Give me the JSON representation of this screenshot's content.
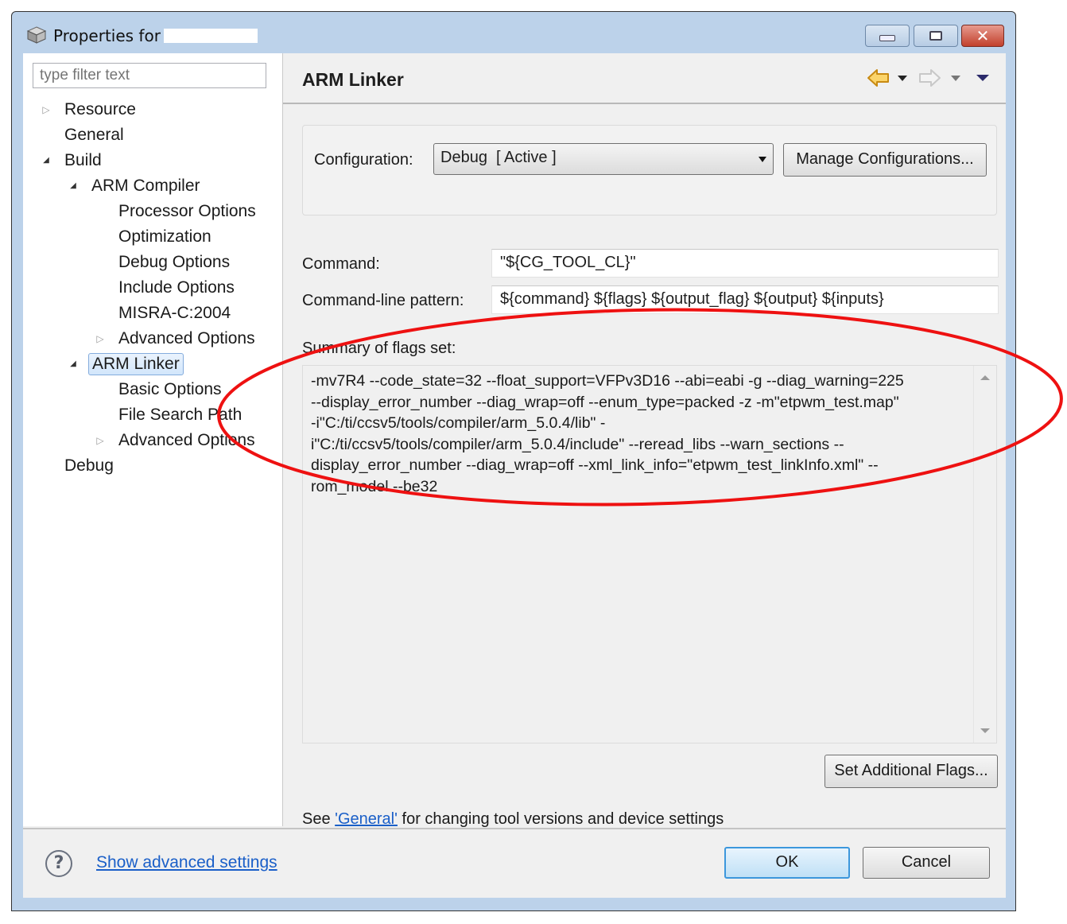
{
  "window": {
    "title": "Properties for",
    "title_redacted": true,
    "controls": {
      "minimize": "minimize",
      "maximize": "maximize",
      "close": "close"
    }
  },
  "sidebar": {
    "filter_placeholder": "type filter text",
    "tree": [
      {
        "label": "Resource",
        "level": 0,
        "twisty": "collapsed"
      },
      {
        "label": "General",
        "level": 0,
        "twisty": "none"
      },
      {
        "label": "Build",
        "level": 0,
        "twisty": "expanded"
      },
      {
        "label": "ARM Compiler",
        "level": 1,
        "twisty": "expanded"
      },
      {
        "label": "Processor Options",
        "level": 2,
        "twisty": "none"
      },
      {
        "label": "Optimization",
        "level": 2,
        "twisty": "none"
      },
      {
        "label": "Debug Options",
        "level": 2,
        "twisty": "none"
      },
      {
        "label": "Include Options",
        "level": 2,
        "twisty": "none"
      },
      {
        "label": "MISRA-C:2004",
        "level": 2,
        "twisty": "none"
      },
      {
        "label": "Advanced Options",
        "level": 2,
        "twisty": "collapsed"
      },
      {
        "label": "ARM Linker",
        "level": 1,
        "twisty": "expanded",
        "selected": true
      },
      {
        "label": "Basic Options",
        "level": 2,
        "twisty": "none"
      },
      {
        "label": "File Search Path",
        "level": 2,
        "twisty": "none"
      },
      {
        "label": "Advanced Options",
        "level": 2,
        "twisty": "collapsed"
      },
      {
        "label": "Debug",
        "level": 0,
        "twisty": "none"
      }
    ]
  },
  "content": {
    "page_title": "ARM Linker",
    "configuration_label": "Configuration:",
    "configuration_value": "Debug  [ Active ]",
    "manage_configurations": "Manage Configurations...",
    "command_label": "Command:",
    "command_value": "\"${CG_TOOL_CL}\"",
    "pattern_label": "Command-line pattern:",
    "pattern_value": "${command} ${flags} ${output_flag} ${output} ${inputs}",
    "summary_label": "Summary of flags set:",
    "summary_lines": [
      "-mv7R4 --code_state=32 --float_support=VFPv3D16 --abi=eabi -g --diag_warning=225",
      "--display_error_number --diag_wrap=off --enum_type=packed -z -m\"etpwm_test.map\"",
      "-i\"C:/ti/ccsv5/tools/compiler/arm_5.0.4/lib\" -",
      "i\"C:/ti/ccsv5/tools/compiler/arm_5.0.4/include\" --reread_libs --warn_sections --",
      "display_error_number --diag_wrap=off --xml_link_info=\"etpwm_test_linkInfo.xml\" --",
      "rom_model --be32"
    ],
    "set_additional_flags": "Set Additional Flags...",
    "footer_see": "See ",
    "footer_link": "'General'",
    "footer_rest": " for changing tool versions and device settings"
  },
  "bottom": {
    "show_advanced": "Show advanced settings",
    "ok": "OK",
    "cancel": "Cancel"
  },
  "annotation": {
    "type": "red-ellipse",
    "color": "#ee1111",
    "encircles": "summary-of-flags"
  },
  "colors": {
    "accent": "#3c97dc",
    "link": "#1a5fc8",
    "window_frame": "#bcd2ea",
    "close_button": "#c2402c"
  }
}
